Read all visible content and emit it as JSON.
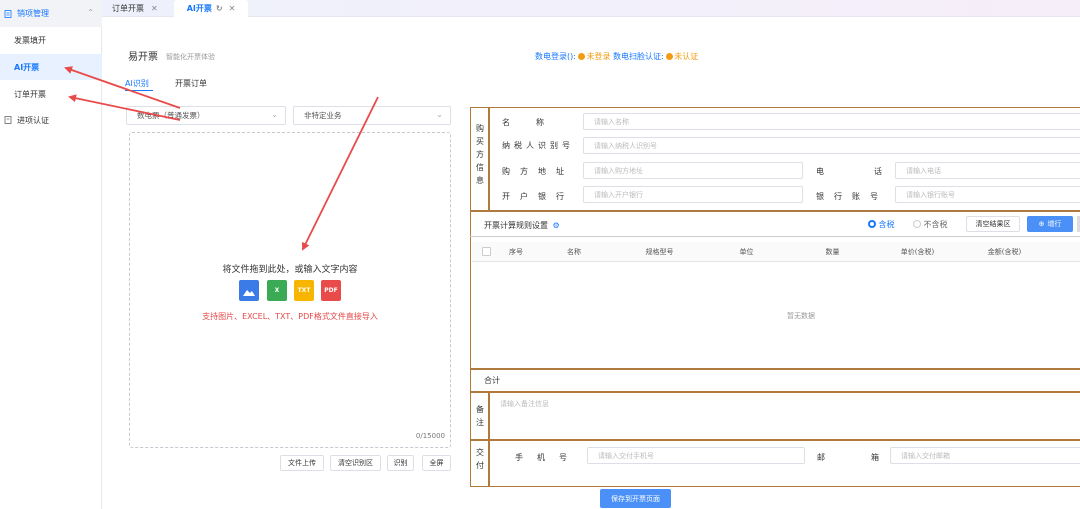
{
  "sidebar": {
    "group_label": "销项管理",
    "items": [
      {
        "label": "发票填开"
      },
      {
        "label": "AI开票"
      },
      {
        "label": "订单开票"
      }
    ],
    "bottom_label": "进项认证"
  },
  "tabs": [
    {
      "label": "订单开票"
    },
    {
      "label": "AI开票"
    }
  ],
  "header": {
    "title": "易开票",
    "subtitle": "智能化开票体验",
    "login_label": "数电登录():",
    "login_status": "未登录",
    "scan_label": "数电扫脸认证:",
    "scan_status": "未认证"
  },
  "subtabs": [
    {
      "label": "AI识别"
    },
    {
      "label": "开票订单"
    }
  ],
  "selects": {
    "invoice_type": "数电票（普通发票）",
    "business_type": "非特定业务"
  },
  "dropzone": {
    "text": "将文件拖到此处，或输入文字内容",
    "tip": "支持图片、EXCEL、TXT、PDF格式文件直接导入",
    "counter": "0/15000",
    "file_types": [
      "image-icon",
      "excel-icon",
      "txt-icon",
      "pdf-icon"
    ],
    "file_marks": [
      "",
      "X",
      "TXT",
      "PDF"
    ],
    "file_colors": [
      "#3b7be8",
      "#3aaa55",
      "#f7b500",
      "#e94a4a"
    ]
  },
  "dz_buttons": [
    {
      "label": "文件上传"
    },
    {
      "label": "清空识别区"
    },
    {
      "label": "识别"
    },
    {
      "label": "全屏"
    }
  ],
  "buyer": {
    "section_label": "购买方信息",
    "name_label": "名称",
    "name_ph": "请输入名称",
    "tax_label": "纳税人识别号",
    "tax_ph": "请输入纳税人识别号",
    "addr_label": "购方地址",
    "addr_ph": "请输入购方地址",
    "phone_label": "电话",
    "phone_ph": "请输入电话",
    "bank_label": "开户银行",
    "bank_ph": "请输入开户银行",
    "account_label": "银行账号",
    "account_ph": "请输入银行账号"
  },
  "rules": {
    "label": "开票计算规则设置",
    "tax_incl": "含税",
    "tax_excl": "不含税",
    "clear_btn": "清空结果区",
    "add_btn": "增行"
  },
  "table": {
    "columns": [
      "序号",
      "名称",
      "规格型号",
      "单位",
      "数量",
      "单价(含税)",
      "金额(含税)"
    ],
    "empty": "暂无数据",
    "total_label": "合计"
  },
  "remark": {
    "label": "备注",
    "ph": "请输入备注信息"
  },
  "delivery": {
    "label": "交付",
    "phone_label": "手机号",
    "phone_ph": "请输入交付手机号",
    "email_label": "邮箱",
    "email_ph": "请输入交付邮箱"
  },
  "save_btn": "保存到开票页面",
  "colors": {
    "accent": "#1677ff",
    "warn": "#f39c12",
    "frame": "#b07a3c",
    "annotation": "#e94a4a"
  }
}
